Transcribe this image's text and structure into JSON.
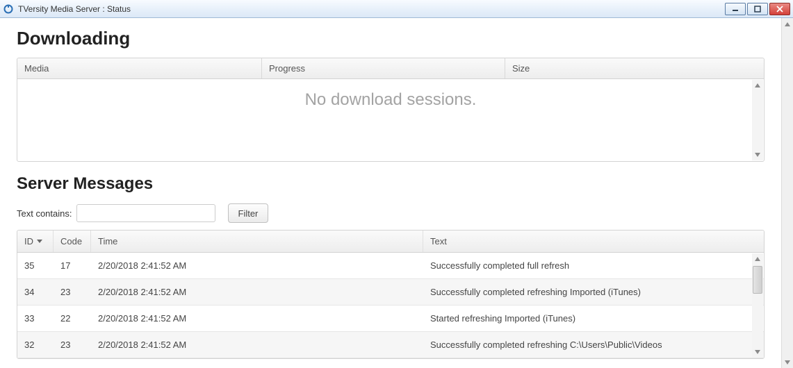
{
  "window": {
    "title": "TVersity Media Server : Status"
  },
  "downloading": {
    "heading": "Downloading",
    "columns": {
      "media": "Media",
      "progress": "Progress",
      "size": "Size"
    },
    "empty_text": "No download sessions."
  },
  "messages": {
    "heading": "Server Messages",
    "filter": {
      "label": "Text contains:",
      "value": "",
      "button": "Filter"
    },
    "columns": {
      "id": "ID",
      "code": "Code",
      "time": "Time",
      "text": "Text"
    },
    "rows": [
      {
        "id": "35",
        "code": "17",
        "time": "2/20/2018 2:41:52 AM",
        "text": "Successfully completed full refresh"
      },
      {
        "id": "34",
        "code": "23",
        "time": "2/20/2018 2:41:52 AM",
        "text": "Successfully completed refreshing Imported (iTunes)"
      },
      {
        "id": "33",
        "code": "22",
        "time": "2/20/2018 2:41:52 AM",
        "text": "Started refreshing Imported (iTunes)"
      },
      {
        "id": "32",
        "code": "23",
        "time": "2/20/2018 2:41:52 AM",
        "text": "Successfully completed refreshing C:\\Users\\Public\\Videos"
      }
    ]
  }
}
